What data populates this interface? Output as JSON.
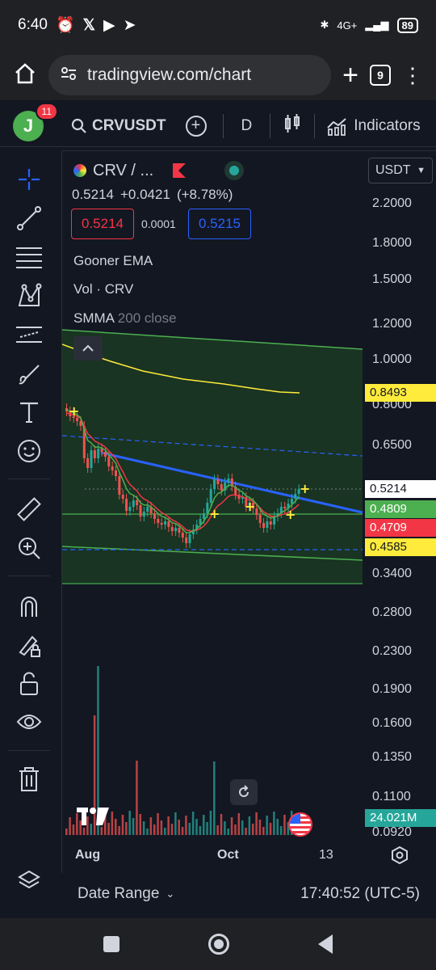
{
  "status": {
    "time": "6:40",
    "network": "4G+",
    "battery": "89"
  },
  "browser": {
    "url": "tradingview.com/chart",
    "tab_count": "9"
  },
  "header": {
    "avatar_letter": "J",
    "notifications": "11",
    "symbol": "CRVUSDT",
    "interval": "D",
    "indicators_label": "Indicators"
  },
  "legend": {
    "pair": "CRV / ...",
    "last_price": "0.5214",
    "change": "+0.0421",
    "change_pct": "(+8.78%)",
    "bid": "0.5214",
    "spread": "0.0001",
    "ask": "0.5215",
    "indicator_1": "Gooner EMA",
    "indicator_2": "Vol · CRV",
    "indicator_3_name": "SMMA",
    "indicator_3_params": "200 close"
  },
  "currency_select": "USDT",
  "price_axis": [
    "2.2000",
    "1.8000",
    "1.5000",
    "1.2000",
    "1.0000",
    "0.8000",
    "0.6500",
    "0.5214",
    "0.4809",
    "0.4709",
    "0.4585",
    "0.3400",
    "0.2800",
    "0.2300",
    "0.1900",
    "0.1600",
    "0.1350",
    "0.1100",
    "0.0920"
  ],
  "price_tags": {
    "smma": {
      "value": "0.8493",
      "color": "#ffeb3b"
    },
    "last": {
      "value": "0.5214",
      "color": "#ffffff"
    },
    "green": {
      "value": "0.4809",
      "color": "#4caf50"
    },
    "red": {
      "value": "0.4709",
      "color": "#f23645"
    },
    "yellow": {
      "value": "0.4585",
      "color": "#ffeb3b"
    },
    "volume": {
      "value": "24.021M",
      "color": "#26a69a"
    }
  },
  "time_axis": [
    "Aug",
    "Oct",
    "13"
  ],
  "footer": {
    "date_range": "Date Range",
    "clock": "17:40:52 (UTC-5)"
  },
  "colors": {
    "bg": "#131722",
    "up": "#26a69a",
    "down": "#ef5350",
    "trend": "#2962ff",
    "channel": "#4caf50"
  }
}
